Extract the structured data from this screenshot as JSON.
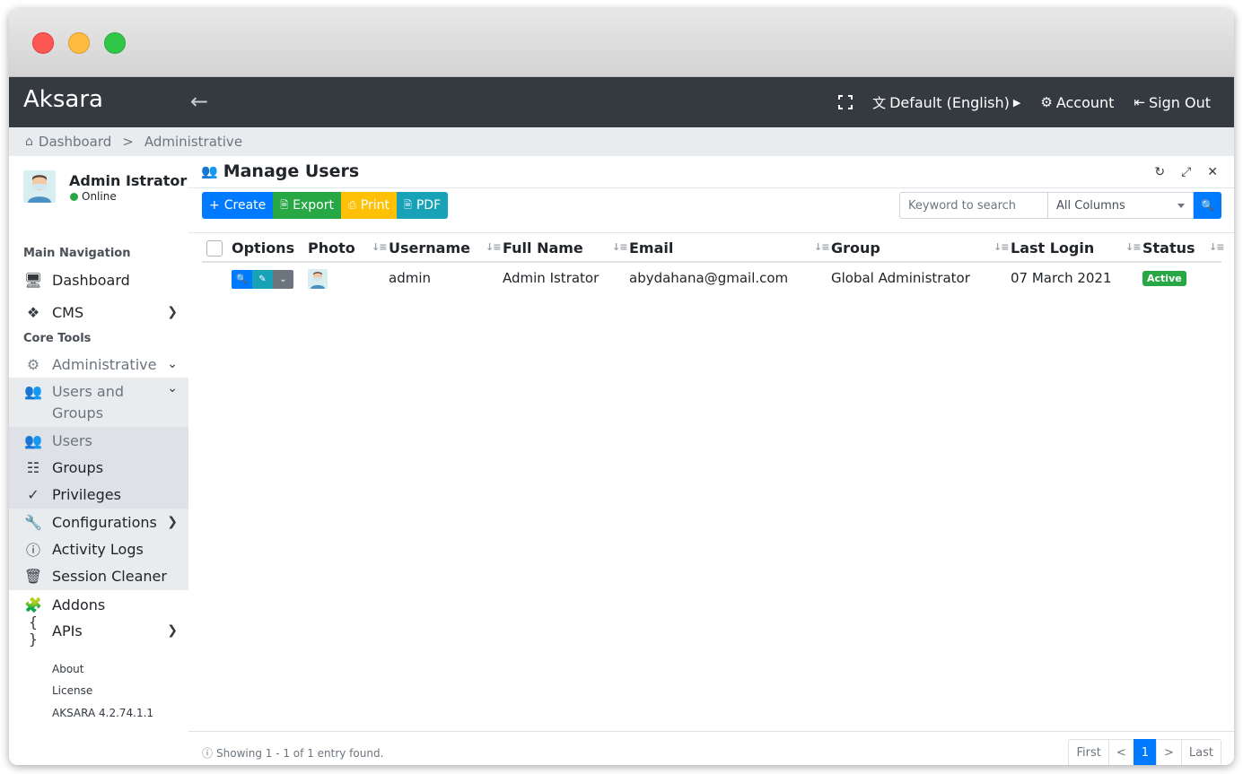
{
  "app": {
    "brand": "Aksara"
  },
  "navbar": {
    "language": "Default (English)",
    "account": "Account",
    "sign_out": "Sign Out"
  },
  "breadcrumb": [
    "Dashboard",
    ">",
    "Administrative"
  ],
  "user": {
    "name": "Admin Istrator",
    "status": "Online"
  },
  "sidebar": {
    "main_header": "Main Navigation",
    "core_header": "Core Tools",
    "items": [
      {
        "label": "Dashboard",
        "icon": "monitor-icon"
      },
      {
        "label": "CMS",
        "icon": "dropbox-icon"
      },
      {
        "label": "Administrative",
        "icon": "gears-icon"
      },
      {
        "label": "Users and Groups",
        "icon": "users-icon"
      },
      {
        "label": "Users",
        "icon": "users-icon"
      },
      {
        "label": "Groups",
        "icon": "sitemap-icon"
      },
      {
        "label": "Privileges",
        "icon": "user-check-icon"
      },
      {
        "label": "Configurations",
        "icon": "wrench-icon"
      },
      {
        "label": "Activity Logs",
        "icon": "info-icon"
      },
      {
        "label": "Session Cleaner",
        "icon": "trash-icon"
      },
      {
        "label": "Addons",
        "icon": "puzzle-icon"
      },
      {
        "label": "APIs",
        "icon": "braces-icon"
      }
    ],
    "footer": {
      "about": "About",
      "license": "License",
      "version": "AKSARA 4.2.74.1.1"
    }
  },
  "panel": {
    "title": "Manage Users"
  },
  "toolbar": {
    "create": "Create",
    "export": "Export",
    "print": "Print",
    "pdf": "PDF"
  },
  "search": {
    "placeholder": "Keyword to search",
    "column": "All Columns"
  },
  "table": {
    "headers": [
      "Options",
      "Photo",
      "Username",
      "Full Name",
      "Email",
      "Group",
      "Last Login",
      "Status"
    ],
    "rows": [
      {
        "username": "admin",
        "full_name": "Admin Istrator",
        "email": "abydahana@gmail.com",
        "group": "Global Administrator",
        "last_login": "07 March 2021",
        "status": "Active"
      }
    ]
  },
  "footer": {
    "showing": "Showing 1 - 1 of 1 entry found.",
    "pagination": [
      "First",
      "<",
      "1",
      ">",
      "Last"
    ]
  },
  "colors": {
    "navbar": "#343a40",
    "primary": "#007bff",
    "success": "#28a745",
    "warning": "#ffc107",
    "info": "#17a2b8"
  }
}
